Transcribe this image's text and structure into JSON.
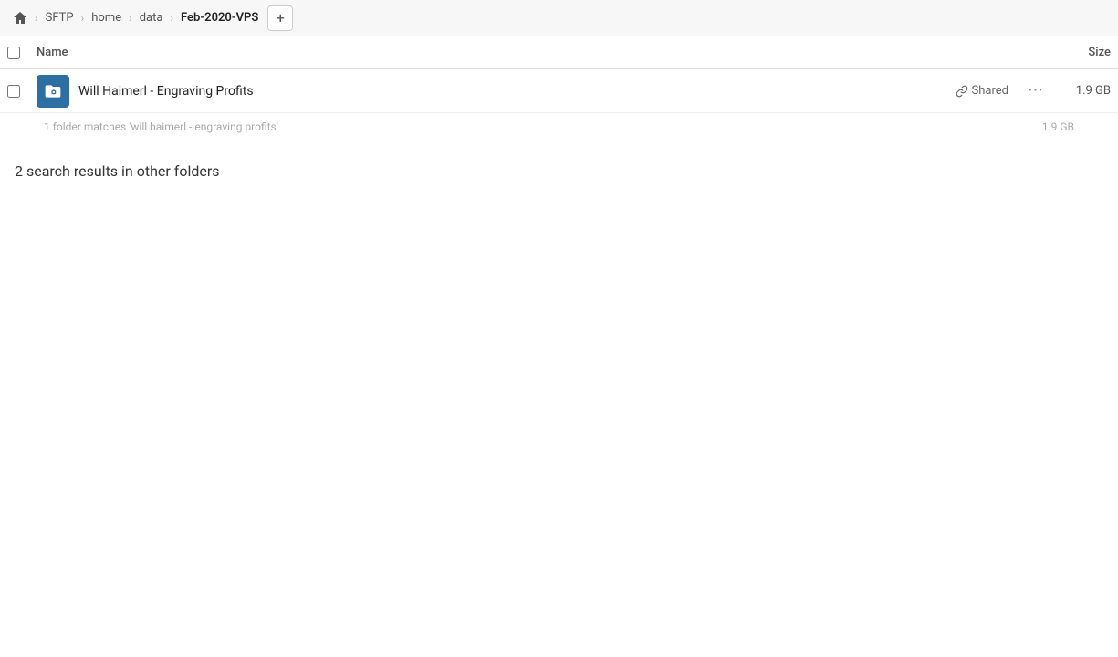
{
  "toolbar": {
    "home_icon": "home",
    "breadcrumbs": [
      {
        "label": "SFTP"
      },
      {
        "label": "home"
      },
      {
        "label": "data"
      },
      {
        "label": "Feb-2020-VPS"
      }
    ],
    "add_button_label": "+"
  },
  "columns": {
    "name_label": "Name",
    "size_label": "Size"
  },
  "file_row": {
    "icon_name": "link-folder-icon",
    "name": "Will Haimerl - Engraving Profits",
    "shared_label": "Shared",
    "more_label": "···",
    "size": "1.9 GB"
  },
  "match_info": {
    "text": "1 folder matches 'will haimerl - engraving profits'",
    "size": "1.9 GB"
  },
  "other_results": {
    "text": "2 search results in other folders"
  }
}
